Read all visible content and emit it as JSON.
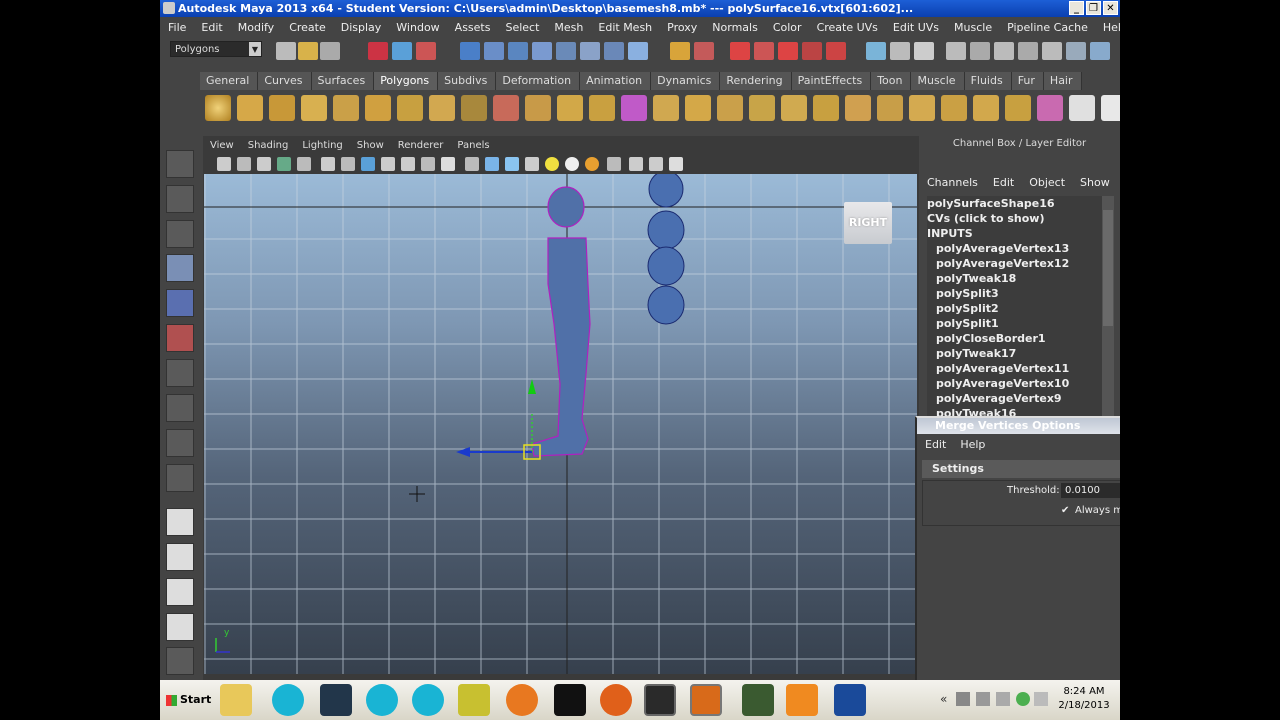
{
  "window": {
    "title": "Autodesk Maya 2013 x64 - Student Version: C:\\Users\\admin\\Desktop\\basemesh8.mb*   ---   polySurface16.vtx[601:602]...",
    "controls": [
      "_",
      "❐",
      "✕"
    ]
  },
  "menubar": [
    "File",
    "Edit",
    "Modify",
    "Create",
    "Display",
    "Window",
    "Assets",
    "Select",
    "Mesh",
    "Edit Mesh",
    "Proxy",
    "Normals",
    "Color",
    "Create UVs",
    "Edit UVs",
    "Muscle",
    "Pipeline Cache",
    "Help"
  ],
  "statusline": {
    "mode_selector": "Polygons"
  },
  "shelf": {
    "tabs": [
      "General",
      "Curves",
      "Surfaces",
      "Polygons",
      "Subdivs",
      "Deformation",
      "Animation",
      "Dynamics",
      "Rendering",
      "PaintEffects",
      "Toon",
      "Muscle",
      "Fluids",
      "Fur",
      "Hair"
    ],
    "active_tab": "Polygons"
  },
  "viewport": {
    "menu": [
      "View",
      "Shading",
      "Lighting",
      "Show",
      "Renderer",
      "Panels"
    ],
    "view_cube_label": "RIGHT",
    "axis_label": "y"
  },
  "channel_box": {
    "title": "Channel Box / Layer Editor",
    "menu": [
      "Channels",
      "Edit",
      "Object",
      "Show"
    ],
    "object_name": "polySurfaceShape16",
    "cvs_label": "CVs (click to show)",
    "inputs_label": "INPUTS",
    "inputs": [
      "polyAverageVertex13",
      "polyAverageVertex12",
      "polyTweak18",
      "polySplit3",
      "polySplit2",
      "polySplit1",
      "polyCloseBorder1",
      "polyTweak17",
      "polyAverageVertex11",
      "polyAverageVertex10",
      "polyAverageVertex9",
      "polyTweak16"
    ]
  },
  "merge_vertices_options": {
    "title": "Merge Vertices Options",
    "menu": [
      "Edit",
      "Help"
    ],
    "section": "Settings",
    "threshold_label": "Threshold:",
    "threshold_value": "0.0100",
    "always_merge_label": "Always m"
  },
  "taskbar": {
    "start_label": "Start",
    "time": "8:24 AM",
    "date": "2/18/2013",
    "tray_arrow": "«"
  }
}
